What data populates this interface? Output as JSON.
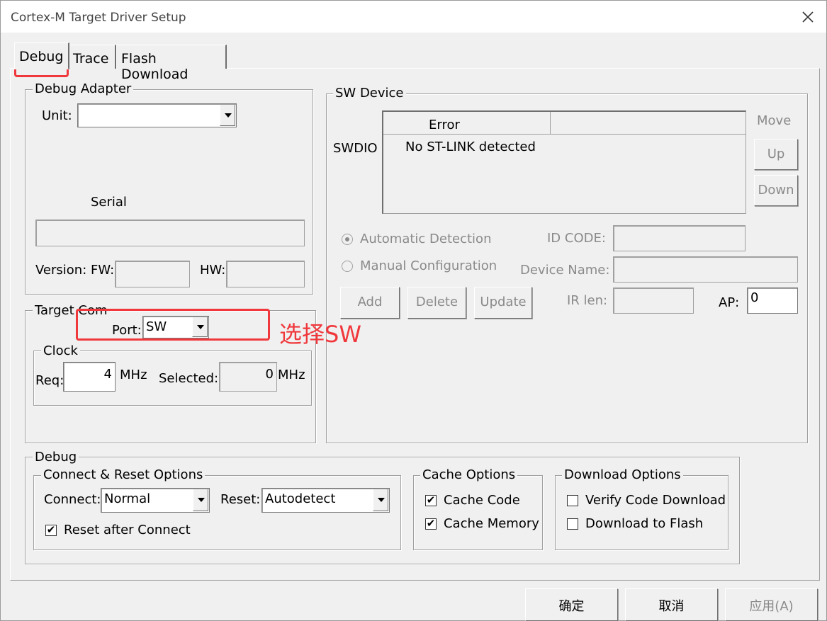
{
  "window": {
    "title": "Cortex-M Target Driver Setup"
  },
  "tabs": [
    {
      "label": "Debug"
    },
    {
      "label": "Trace"
    },
    {
      "label": "Flash Download"
    }
  ],
  "debug_adapter": {
    "group_label": "Debug Adapter",
    "unit_label": "Unit:",
    "unit_value": "",
    "serial_label": "Serial",
    "serial_value": "",
    "version_label": "Version: FW:",
    "fw_value": "",
    "hw_label": "HW:",
    "hw_value": ""
  },
  "target_com": {
    "group_label": "Target Com",
    "port_label": "Port:",
    "port_value": "SW",
    "annotation": "选择SW",
    "clock": {
      "group_label": "Clock",
      "req_label": "Req:",
      "req_value": "4",
      "req_unit": "MHz",
      "selected_label": "Selected:",
      "selected_value": "0",
      "selected_unit": "MHz"
    }
  },
  "sw_device": {
    "group_label": "SW Device",
    "row_label": "SWDIO",
    "columns": [
      "Error",
      ""
    ],
    "rows": [
      [
        "No ST-LINK detected",
        ""
      ]
    ],
    "move_label": "Move",
    "up_label": "Up",
    "down_label": "Down",
    "auto_detect_label": "Automatic Detection",
    "manual_config_label": "Manual Configuration",
    "id_code_label": "ID CODE:",
    "device_name_label": "Device Name:",
    "add_label": "Add",
    "delete_label": "Delete",
    "update_label": "Update",
    "ir_len_label": "IR len:",
    "ap_label": "AP:",
    "ap_value": "0"
  },
  "debug": {
    "group_label": "Debug",
    "connect_reset": {
      "group_label": "Connect & Reset Options",
      "connect_label": "Connect:",
      "connect_value": "Normal",
      "reset_label": "Reset:",
      "reset_value": "Autodetect",
      "reset_after_connect_label": "Reset after Connect",
      "reset_after_connect_checked": true
    },
    "cache": {
      "group_label": "Cache Options",
      "cache_code_label": "Cache Code",
      "cache_code_checked": true,
      "cache_memory_label": "Cache Memory",
      "cache_memory_checked": true
    },
    "download": {
      "group_label": "Download Options",
      "verify_label": "Verify Code Download",
      "verify_checked": false,
      "flash_label": "Download to Flash",
      "flash_checked": false
    }
  },
  "footer": {
    "ok_label": "确定",
    "cancel_label": "取消",
    "apply_label": "应用(A)"
  },
  "colors": {
    "highlight": "#f0383c"
  }
}
